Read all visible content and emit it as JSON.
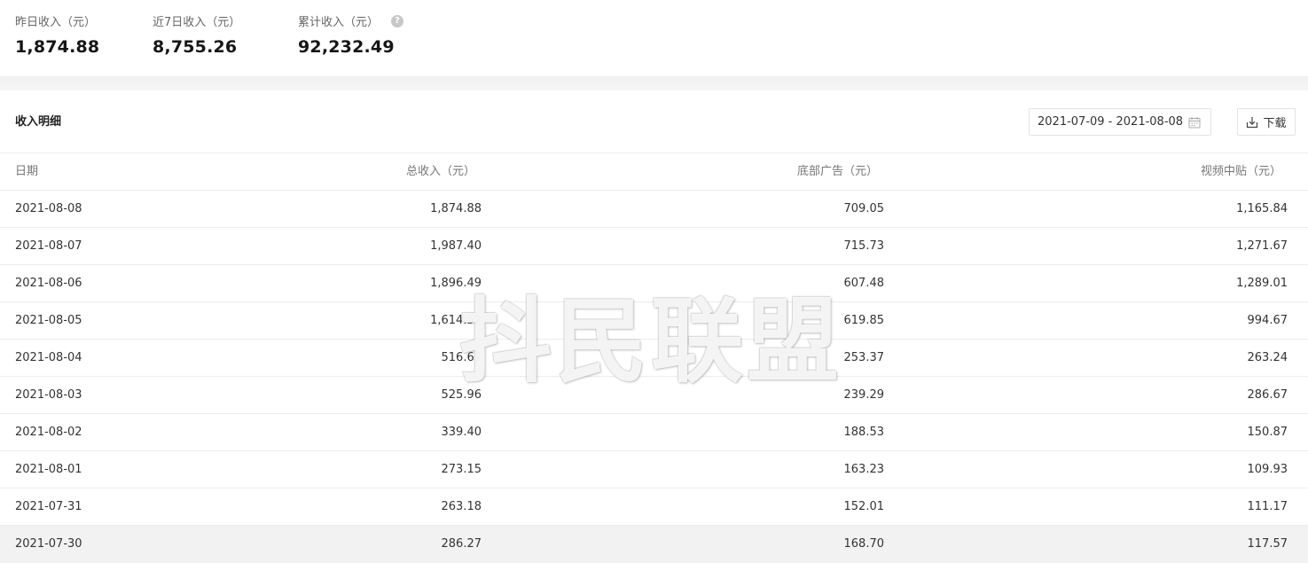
{
  "summary": {
    "yesterday": {
      "label": "昨日收入（元）",
      "value": "1,874.88"
    },
    "last7days": {
      "label": "近7日收入（元）",
      "value": "8,755.26"
    },
    "total": {
      "label": "累计收入（元）",
      "value": "92,232.49",
      "help_icon": "question-circle-icon"
    }
  },
  "detail": {
    "title": "收入明细",
    "date_range": "2021-07-09 - 2021-08-08",
    "download_label": "下载",
    "columns": [
      "日期",
      "总收入（元）",
      "底部广告（元）",
      "视频中贴（元）"
    ],
    "rows": [
      [
        "2021-08-08",
        "1,874.88",
        "709.05",
        "1,165.84"
      ],
      [
        "2021-08-07",
        "1,987.40",
        "715.73",
        "1,271.67"
      ],
      [
        "2021-08-06",
        "1,896.49",
        "607.48",
        "1,289.01"
      ],
      [
        "2021-08-05",
        "1,614.52",
        "619.85",
        "994.67"
      ],
      [
        "2021-08-04",
        "516.61",
        "253.37",
        "263.24"
      ],
      [
        "2021-08-03",
        "525.96",
        "239.29",
        "286.67"
      ],
      [
        "2021-08-02",
        "339.40",
        "188.53",
        "150.87"
      ],
      [
        "2021-08-01",
        "273.15",
        "163.23",
        "109.93"
      ],
      [
        "2021-07-31",
        "263.18",
        "152.01",
        "111.17"
      ],
      [
        "2021-07-30",
        "286.27",
        "168.70",
        "117.57"
      ]
    ]
  },
  "watermark": "抖民联盟",
  "colors": {
    "hover_row": "#f2f2f2",
    "label_gray": "#666666"
  }
}
